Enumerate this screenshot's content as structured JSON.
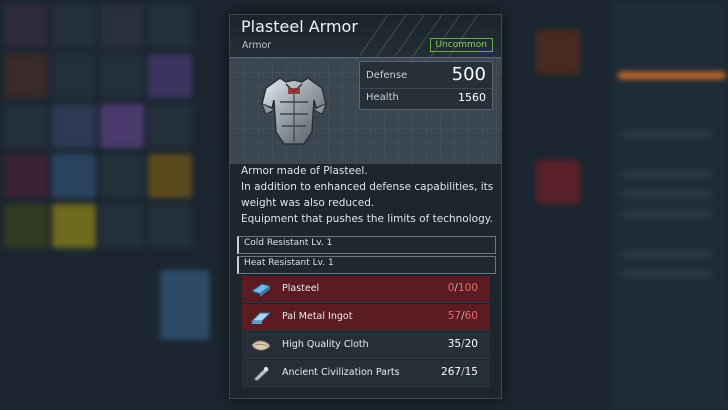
{
  "item": {
    "name": "Plasteel Armor",
    "category": "Armor",
    "rarity": "Uncommon",
    "icon": "armor-icon"
  },
  "stats": {
    "defense_label": "Defense",
    "defense_value": "500",
    "health_label": "Health",
    "health_value": "1560"
  },
  "description": [
    "Armor made of Plasteel.",
    "In addition to enhanced defense capabilities, its",
    "weight was also reduced.",
    "Equipment that pushes the limits of technology."
  ],
  "effects": [
    "Cold Resistant Lv. 1",
    "Heat Resistant Lv. 1"
  ],
  "materials": [
    {
      "name": "Plasteel",
      "have": "0",
      "need": "100",
      "sufficient": false,
      "icon": "plasteel-icon"
    },
    {
      "name": "Pal Metal Ingot",
      "have": "57",
      "need": "60",
      "sufficient": false,
      "icon": "pal-metal-ingot-icon"
    },
    {
      "name": "High Quality Cloth",
      "have": "35",
      "need": "20",
      "sufficient": true,
      "icon": "cloth-icon"
    },
    {
      "name": "Ancient Civilization Parts",
      "have": "267",
      "need": "15",
      "sufficient": true,
      "icon": "ancient-parts-icon"
    }
  ],
  "colors": {
    "rarity": "#8fcf5e",
    "insufficient": "#e86a6a",
    "insufficient_row": "#5a1c22"
  }
}
